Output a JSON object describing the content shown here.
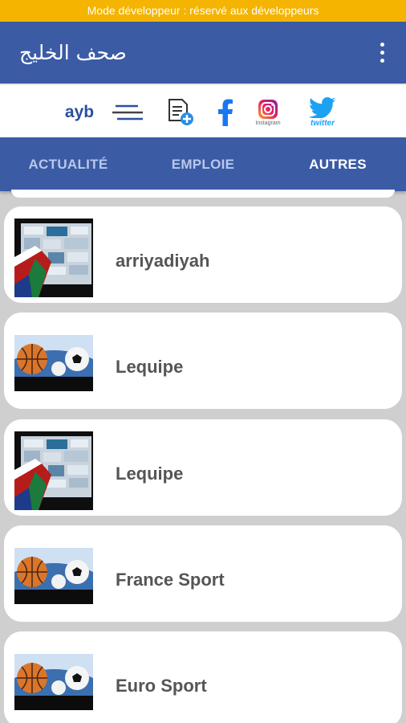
{
  "status": {
    "dev_mode": "Mode développeur : réservé aux développeurs"
  },
  "appbar": {
    "title": "صحف الخليج"
  },
  "iconbar": {
    "ayb": "ayb",
    "instagram_caption": "Instagram",
    "twitter_caption": "twitter"
  },
  "tabs": [
    {
      "label": "ACTUALITÉ",
      "active": false
    },
    {
      "label": "EMPLOIE",
      "active": false
    },
    {
      "label": "AUTRES",
      "active": true
    }
  ],
  "items": [
    {
      "title": "arriyadiyah",
      "thumbnail": "newspapers-collage"
    },
    {
      "title": "Lequipe",
      "thumbnail": "sports-balls"
    },
    {
      "title": "Lequipe",
      "thumbnail": "newspapers-collage"
    },
    {
      "title": "France Sport",
      "thumbnail": "sports-balls"
    },
    {
      "title": "Euro Sport",
      "thumbnail": "sports-balls"
    }
  ],
  "colors": {
    "primary": "#3b5ba5",
    "banner": "#f4b400",
    "ayb": "#2c4f9e",
    "facebook": "#1877f2",
    "twitter": "#1da1f2"
  }
}
